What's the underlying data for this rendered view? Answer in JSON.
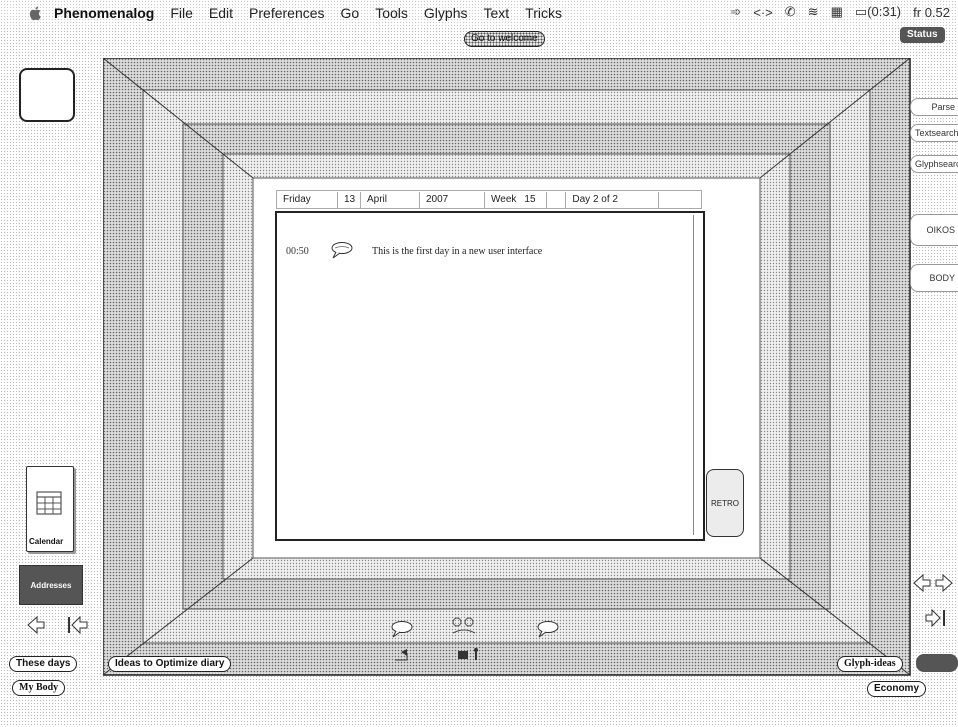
{
  "menubar": {
    "app_name": "Phenomenalog",
    "items": [
      "File",
      "Edit",
      "Preferences",
      "Go",
      "Tools",
      "Glyphs",
      "Text",
      "Tricks"
    ],
    "battery": "(0:31)",
    "flag": "fr 0.52"
  },
  "welcome_button": "Go to welcome",
  "status_button": "Status",
  "right_tabs": {
    "parse": "Parse",
    "textsearch": "Textsearch",
    "glyphsearch": "Glyphsearch",
    "oikos": "OIKOS",
    "body": "BODY"
  },
  "diary": {
    "weekday": "Friday",
    "day": "13",
    "month": "April",
    "year": "2007",
    "week_label": "Week",
    "week": "15",
    "day_of": "Day 2 of 2",
    "entry_time": "00:50",
    "entry_text": "This is the first day in a new user interface"
  },
  "retro_button": "RETRO",
  "left_panel": {
    "calendar_label": "Calendar",
    "addresses_label": "Addresses"
  },
  "bottom": {
    "these_days": "These days",
    "my_body": "My Body",
    "ideas": "Ideas to Optimize diary",
    "glyph_ideas": "Glyph-ideas",
    "economy": "Economy"
  },
  "icons": {
    "apple": "apple-icon",
    "speech": "speech-bubble-icon"
  }
}
